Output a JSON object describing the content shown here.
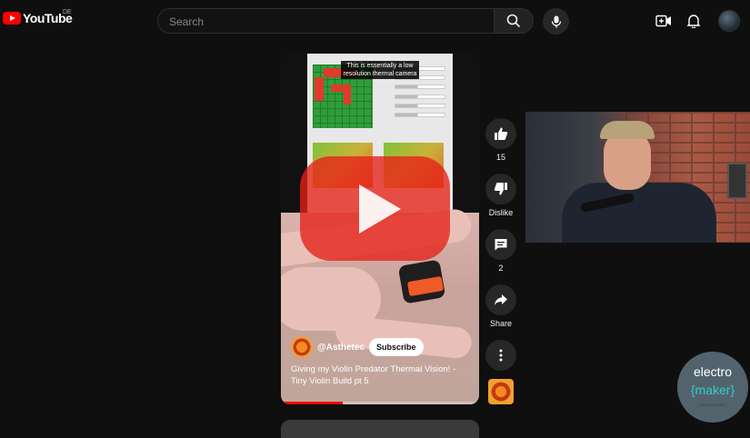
{
  "header": {
    "logo_text": "YouTube",
    "region": "DE",
    "search_placeholder": "Search"
  },
  "short": {
    "caption": "This is essentially a low resolution thermal camera",
    "channel": "@Asthetec",
    "subscribe_label": "Subscribe",
    "title": "Giving my Violin Predator Thermal Vision! - Tiny Violin Build pt 5",
    "progress": 0.31
  },
  "actions": {
    "like_count": "15",
    "dislike_label": "Dislike",
    "comment_count": "2",
    "share_label": "Share"
  },
  "watermark": {
    "line1": "electro",
    "line2": "{maker}",
    "small": "electromaker"
  },
  "colors": {
    "accent": "#ff0000",
    "background": "#0f0f0f"
  }
}
